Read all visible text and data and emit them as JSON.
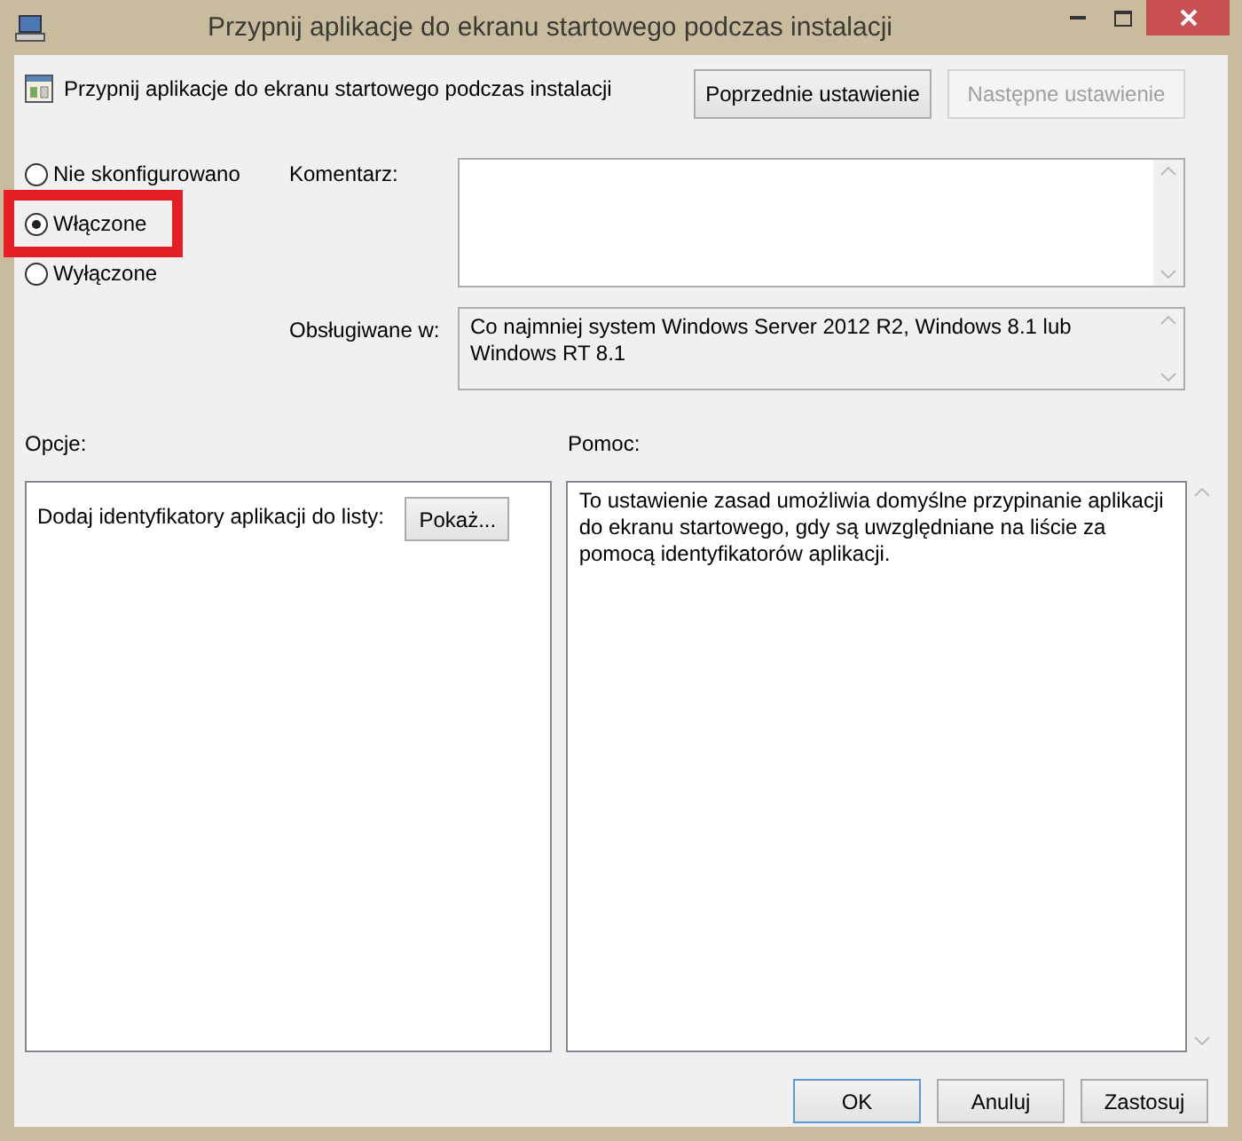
{
  "window": {
    "title": "Przypnij aplikacje do ekranu startowego podczas instalacji"
  },
  "header": {
    "title": "Przypnij aplikacje do ekranu startowego podczas instalacji",
    "buttons": [
      {
        "label": "Poprzednie ustawienie",
        "disabled": false
      },
      {
        "label": "Następne ustawienie",
        "disabled": true
      }
    ]
  },
  "state_options": [
    {
      "label": "Nie skonfigurowano",
      "selected": false,
      "highlighted": false
    },
    {
      "label": "Włączone",
      "selected": true,
      "highlighted": true
    },
    {
      "label": "Wyłączone",
      "selected": false,
      "highlighted": false
    }
  ],
  "comment": {
    "label": "Komentarz:"
  },
  "supported": {
    "label": "Obsługiwane w:",
    "value": "Co najmniej system Windows Server 2012 R2, Windows 8.1 lub Windows RT 8.1"
  },
  "options": {
    "label": "Opcje:",
    "items": [
      {
        "label": "Dodaj identyfikatory aplikacji do listy:",
        "button": "Pokaż..."
      }
    ]
  },
  "help": {
    "label": "Pomoc:",
    "text": "To ustawienie zasad umożliwia domyślne przypinanie aplikacji do ekranu startowego, gdy są uwzględniane na liście za pomocą identyfikatorów aplikacji."
  },
  "buttons": [
    {
      "label": "OK",
      "default": true
    },
    {
      "label": "Anuluj",
      "default": false
    },
    {
      "label": "Zastosuj",
      "default": false
    }
  ]
}
